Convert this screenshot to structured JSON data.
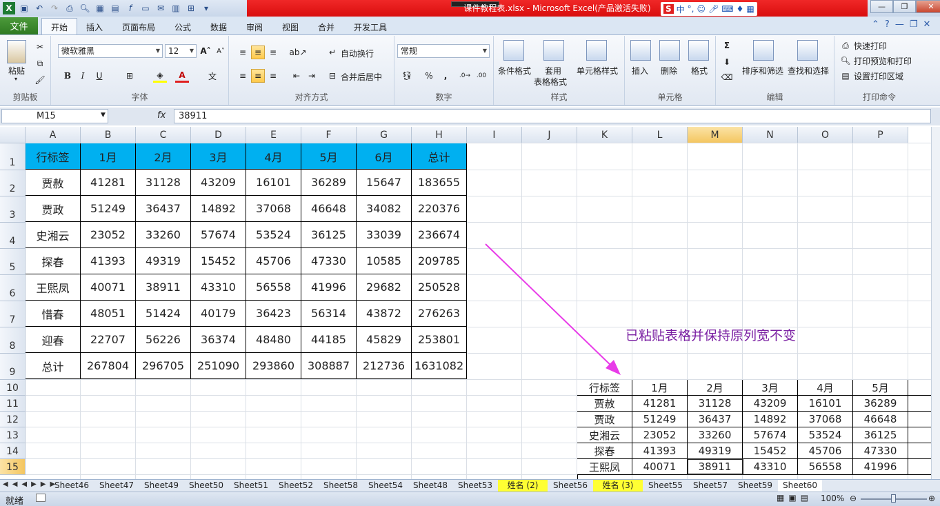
{
  "window": {
    "title": "课件教程表.xlsx - Microsoft Excel(产品激活失败)",
    "controls": [
      "—",
      "❐",
      "✕"
    ]
  },
  "ribbon_tabs": [
    "文件",
    "开始",
    "插入",
    "页面布局",
    "公式",
    "数据",
    "审阅",
    "视图",
    "合并",
    "开发工具"
  ],
  "ribbon": {
    "clipboard": {
      "label": "剪贴板",
      "paste": "粘贴"
    },
    "font": {
      "label": "字体",
      "family": "微软雅黑",
      "size": "12",
      "bold": "B",
      "italic": "I",
      "underline": "U"
    },
    "alignment": {
      "label": "对齐方式",
      "wrap": "自动换行",
      "merge": "合并后居中"
    },
    "number": {
      "label": "数字",
      "format": "常规",
      "percent": "%",
      "comma": ","
    },
    "styles": {
      "label": "样式",
      "cond": "条件格式",
      "table1": "套用",
      "table2": "表格格式",
      "cell": "单元格样式"
    },
    "cells": {
      "label": "单元格",
      "insert": "插入",
      "delete": "删除",
      "format": "格式"
    },
    "edit": {
      "label": "编辑",
      "sigma": "Σ",
      "sort": "排序和筛选",
      "find": "查找和选择"
    },
    "print": {
      "label": "打印命令",
      "quick": "快速打印",
      "preview": "打印预览和打印",
      "area": "设置打印区域"
    }
  },
  "formula_bar": {
    "name_box": "M15",
    "fx": "fx",
    "value": "38911"
  },
  "columns": [
    "A",
    "B",
    "C",
    "D",
    "E",
    "F",
    "G",
    "H",
    "I",
    "J",
    "K",
    "L",
    "M",
    "N",
    "O",
    "P"
  ],
  "rows": [
    "1",
    "2",
    "3",
    "4",
    "5",
    "6",
    "7",
    "8",
    "9",
    "10",
    "11",
    "12",
    "13",
    "14",
    "15"
  ],
  "table": {
    "header": [
      "行标签",
      "1月",
      "2月",
      "3月",
      "4月",
      "5月",
      "6月",
      "总计"
    ],
    "rows": [
      [
        "贾赦",
        "41281",
        "31128",
        "43209",
        "16101",
        "36289",
        "15647",
        "183655"
      ],
      [
        "贾政",
        "51249",
        "36437",
        "14892",
        "37068",
        "46648",
        "34082",
        "220376"
      ],
      [
        "史湘云",
        "23052",
        "33260",
        "57674",
        "53524",
        "36125",
        "33039",
        "236674"
      ],
      [
        "探春",
        "41393",
        "49319",
        "15452",
        "45706",
        "47330",
        "10585",
        "209785"
      ],
      [
        "王熙凤",
        "40071",
        "38911",
        "43310",
        "56558",
        "41996",
        "29682",
        "250528"
      ],
      [
        "惜春",
        "48051",
        "51424",
        "40179",
        "36423",
        "56314",
        "43872",
        "276263"
      ],
      [
        "迎春",
        "22707",
        "56226",
        "36374",
        "48480",
        "44185",
        "45829",
        "253801"
      ],
      [
        "总计",
        "267804",
        "296705",
        "251090",
        "293860",
        "308887",
        "212736",
        "1631082"
      ]
    ]
  },
  "pasted_table": {
    "header": [
      "行标签",
      "1月",
      "2月",
      "3月",
      "4月",
      "5月"
    ],
    "rows": [
      [
        "贾赦",
        "41281",
        "31128",
        "43209",
        "16101",
        "36289"
      ],
      [
        "贾政",
        "51249",
        "36437",
        "14892",
        "37068",
        "46648"
      ],
      [
        "史湘云",
        "23052",
        "33260",
        "57674",
        "53524",
        "36125"
      ],
      [
        "探春",
        "41393",
        "49319",
        "15452",
        "45706",
        "47330"
      ],
      [
        "王熙凤",
        "40071",
        "38911",
        "43310",
        "56558",
        "41996"
      ]
    ]
  },
  "annotation": "已粘贴表格并保持原列宽不变",
  "sheet_tabs": [
    "Sheet46",
    "Sheet47",
    "Sheet49",
    "Sheet50",
    "Sheet51",
    "Sheet52",
    "Sheet58",
    "Sheet54",
    "Sheet48",
    "Sheet53",
    "姓名 (2)",
    "Sheet56",
    "姓名 (3)",
    "Sheet55",
    "Sheet57",
    "Sheet59",
    "Sheet60"
  ],
  "status": {
    "ready": "就绪",
    "zoom": "100%"
  },
  "colors": {
    "header_fill": "#00b0f0",
    "arrow": "#e83be8",
    "annotation": "#7a1fa2",
    "title_red": "#e01818"
  }
}
